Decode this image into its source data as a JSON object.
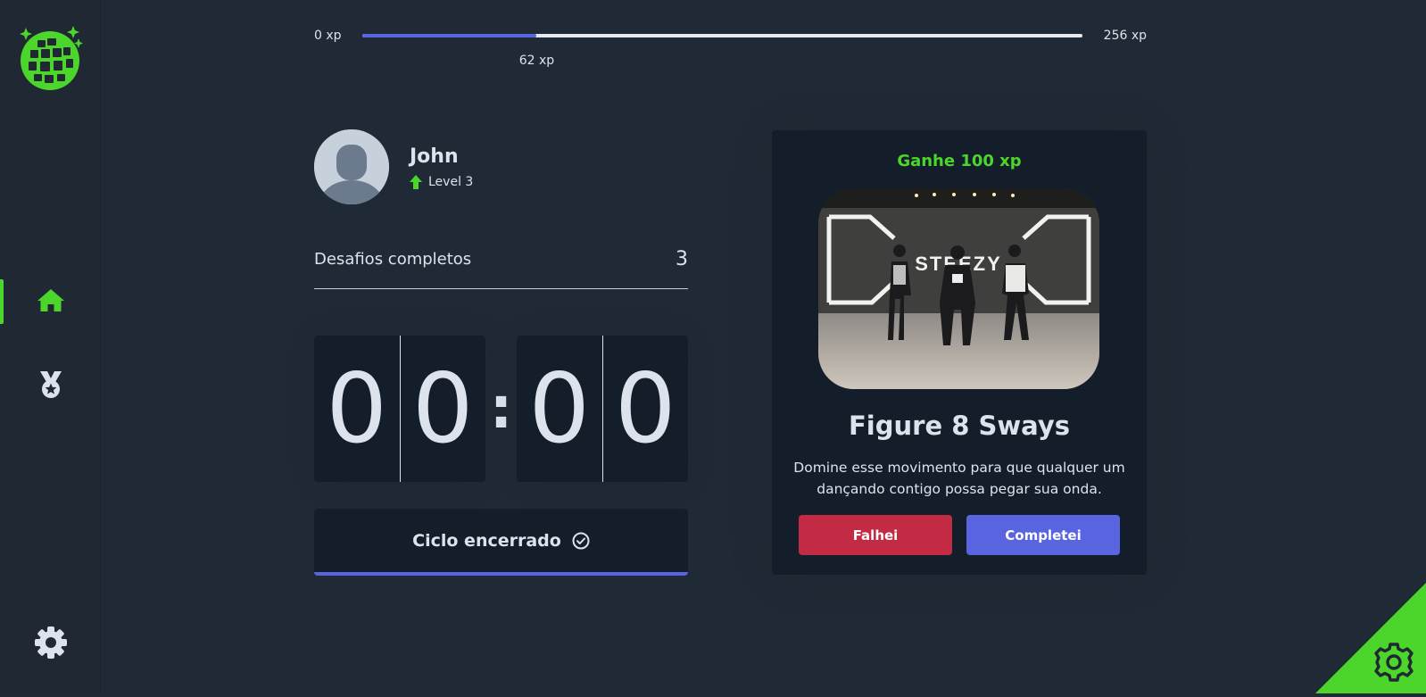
{
  "colors": {
    "background": "#202a36",
    "sidebar": "#1f2833",
    "card": "#141e2b",
    "accent_green": "#4cd62b",
    "accent_blue": "#5965e0",
    "danger_red": "#c32b45",
    "text": "#dce3ec"
  },
  "sidebar": {
    "logo": "disco-ball-logo",
    "items": [
      {
        "icon": "home-icon",
        "active": true
      },
      {
        "icon": "medal-icon",
        "active": false
      }
    ],
    "settings_icon": "gear-icon"
  },
  "xp_bar": {
    "min_label": "0 xp",
    "max_label": "256 xp",
    "current_label": "62 xp",
    "current": 62,
    "max": 256
  },
  "profile": {
    "name": "John",
    "level_label": "Level 3"
  },
  "challenges": {
    "label": "Desafios completos",
    "count": "3"
  },
  "countdown": {
    "minute_left": "0",
    "minute_right": "0",
    "separator": ":",
    "second_left": "0",
    "second_right": "0"
  },
  "cycle_button": {
    "label": "Ciclo encerrado"
  },
  "challenge_card": {
    "reward": "Ganhe 100 xp",
    "title": "Figure 8 Sways",
    "description": "Domine esse movimento para que qualquer um dançando contigo possa pegar sua onda.",
    "fail_label": "Falhei",
    "complete_label": "Completei",
    "image_sign": "STEEZY"
  },
  "corner_icon": "gear-icon"
}
